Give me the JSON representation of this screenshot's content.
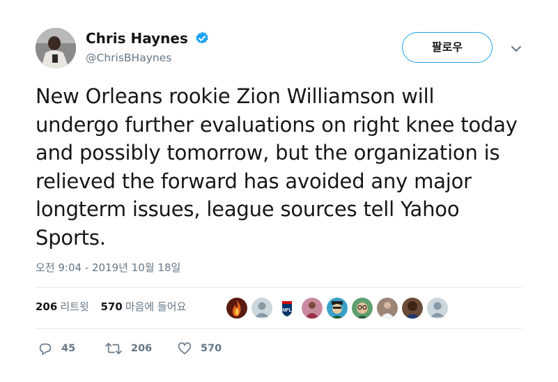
{
  "author": {
    "display_name": "Chris Haynes",
    "handle": "@ChrisBHaynes",
    "verified_color": "#1da1f2"
  },
  "follow_button": {
    "label": "팔로우"
  },
  "more_menu_icon": "chevron-down-icon",
  "tweet_text": "New Orleans rookie Zion Williamson will undergo further evaluations on right knee today and possibly tomorrow, but the organization is relieved the forward has avoided any major longterm issues, league sources tell Yahoo Sports.",
  "timestamp": "오전 9:04 - 2019년 10월 18일",
  "stats": {
    "retweet_count": "206",
    "retweet_label": "리트윗",
    "like_count": "570",
    "like_label": "마음에 들어요"
  },
  "likers": [
    {
      "icon": "avatar-fire",
      "color": "#c0392b"
    },
    {
      "icon": "avatar-default",
      "color": "#ccd6dd"
    },
    {
      "icon": "avatar-nfl-logo",
      "color": "#013369"
    },
    {
      "icon": "avatar-photo",
      "color": "#b85a7a"
    },
    {
      "icon": "avatar-cartoon",
      "color": "#2a6f8f"
    },
    {
      "icon": "avatar-cartoon-glasses",
      "color": "#3b7a57"
    },
    {
      "icon": "avatar-photo",
      "color": "#7b5e57"
    },
    {
      "icon": "avatar-photo",
      "color": "#3d2b23"
    },
    {
      "icon": "avatar-default",
      "color": "#ccd6dd"
    }
  ],
  "actions": {
    "reply_count": "45",
    "retweet_count": "206",
    "like_count": "570"
  },
  "colors": {
    "text": "#14171a",
    "secondary": "#657786",
    "accent": "#1da1f2",
    "divider": "#e6ecf0"
  }
}
